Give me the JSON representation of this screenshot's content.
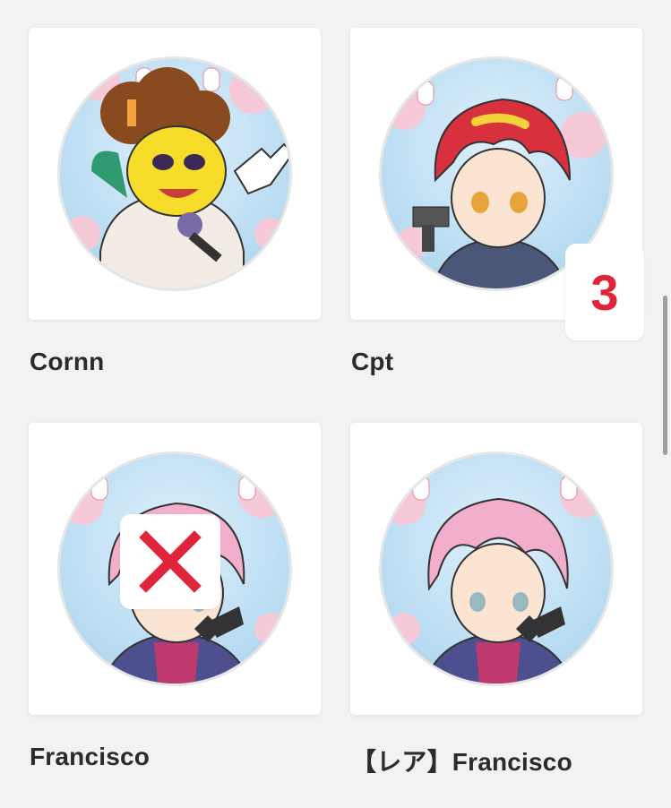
{
  "items": [
    {
      "name": "Cornn"
    },
    {
      "name": "Cpt",
      "badge": "3"
    },
    {
      "name": "Francisco",
      "badge_icon": "cross-mark-icon"
    },
    {
      "name": "【レア】Francisco"
    }
  ],
  "colors": {
    "badge_red": "#e0253a",
    "sky": "#b9dcf2",
    "blossom": "#f6c9d8"
  }
}
